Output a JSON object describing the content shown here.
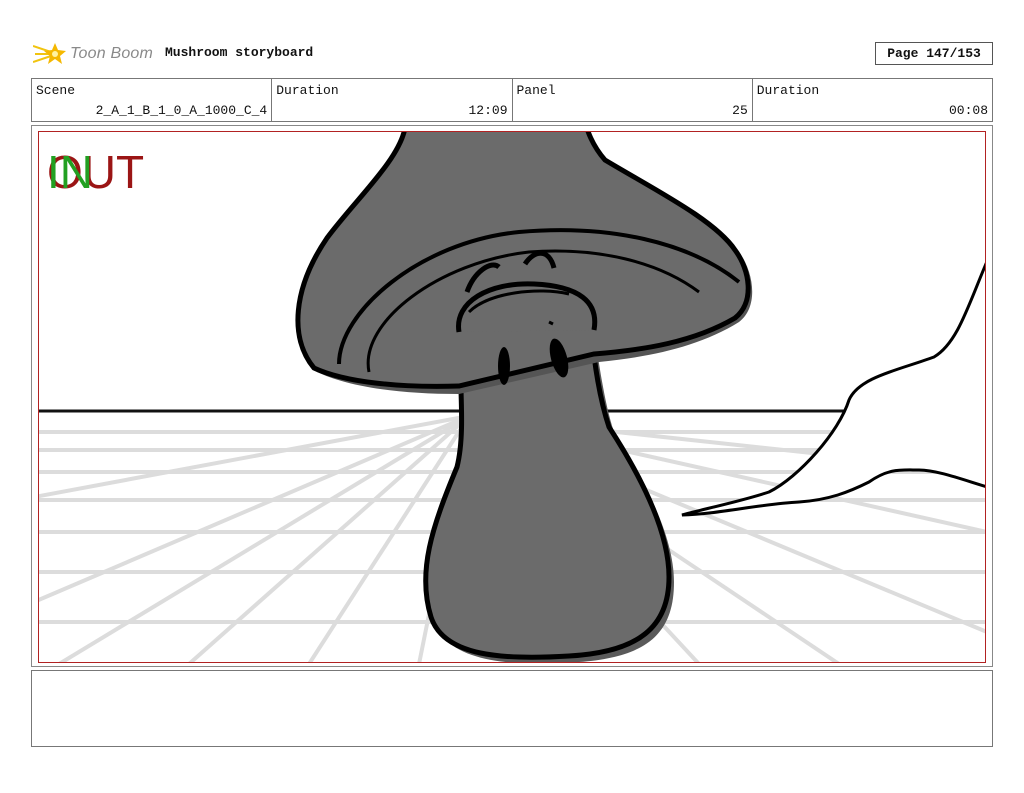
{
  "header": {
    "brand": "Toon Boom",
    "logo_icon": "toon-boom-star-icon",
    "title": "Mushroom storyboard",
    "page": "Page 147/153"
  },
  "info": {
    "scene_label": "Scene",
    "scene_value": "2_A_1_B_1_0_A_1000_C_4",
    "duration_label": "Duration",
    "duration_value": "12:09",
    "panel_label": "Panel",
    "panel_value": "25",
    "panel_duration_label": "Duration",
    "panel_duration_value": "00:08"
  },
  "panel": {
    "in_marker": "IN",
    "out_marker": "OUT",
    "in_color": "#22a022",
    "out_color": "#9b1515"
  },
  "notes": {
    "text": ""
  }
}
